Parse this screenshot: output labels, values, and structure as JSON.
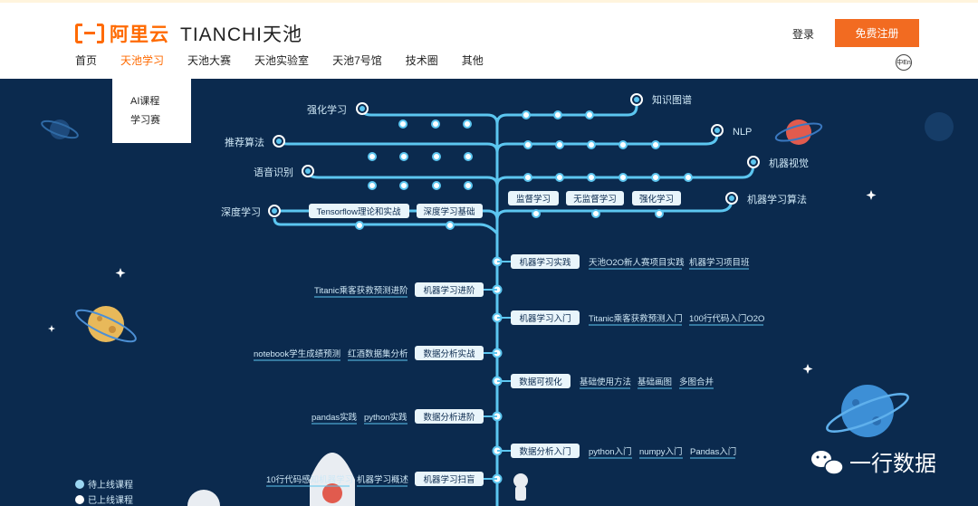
{
  "brand": {
    "cn": "阿里云",
    "en": "TIANCHI天池"
  },
  "header": {
    "login": "登录",
    "register": "免费注册",
    "lang": "中En"
  },
  "nav": [
    "首页",
    "天池学习",
    "天池大赛",
    "天池实验室",
    "天池7号馆",
    "技术圈",
    "其他"
  ],
  "dropdown": [
    "AI课程",
    "学习赛"
  ],
  "branches_left": [
    "强化学习",
    "推荐算法",
    "语音识别",
    "深度学习"
  ],
  "branches_right": [
    "知识图谱",
    "NLP",
    "机器视觉",
    "机器学习算法"
  ],
  "chips_deep": [
    "Tensorflow理论和实战",
    "深度学习基础"
  ],
  "chips_ml": [
    "监督学习",
    "无监督学习",
    "强化学习"
  ],
  "rows": [
    {
      "stage": "机器学习实践",
      "side": "right",
      "links": [
        "天池O2O新人赛项目实践",
        "机器学习项目班"
      ]
    },
    {
      "stage": "机器学习进阶",
      "side": "left",
      "links": [
        "Titanic乘客获救预测进阶"
      ]
    },
    {
      "stage": "机器学习入门",
      "side": "right",
      "links": [
        "Titanic乘客获救预测入门",
        "100行代码入门O2O"
      ]
    },
    {
      "stage": "数据分析实战",
      "side": "left",
      "links": [
        "notebook学生成绩预测",
        "红酒数据集分析"
      ]
    },
    {
      "stage": "数据可视化",
      "side": "right",
      "links": [
        "基础使用方法",
        "基础画图",
        "多图合并"
      ]
    },
    {
      "stage": "数据分析进阶",
      "side": "left",
      "links": [
        "pandas实践",
        "python实践"
      ]
    },
    {
      "stage": "数据分析入门",
      "side": "right",
      "links": [
        "python入门",
        "numpy入门",
        "Pandas入门"
      ]
    },
    {
      "stage": "机器学习扫盲",
      "side": "left",
      "links": [
        "10行代码感知机器学习",
        "机器学习概述"
      ]
    }
  ],
  "legend": [
    "待上线课程",
    "已上线课程"
  ],
  "watermark": "一行数据",
  "colors": {
    "accent": "#ff6a00",
    "bg": "#0b2a4e",
    "line": "#5cc6f0"
  }
}
